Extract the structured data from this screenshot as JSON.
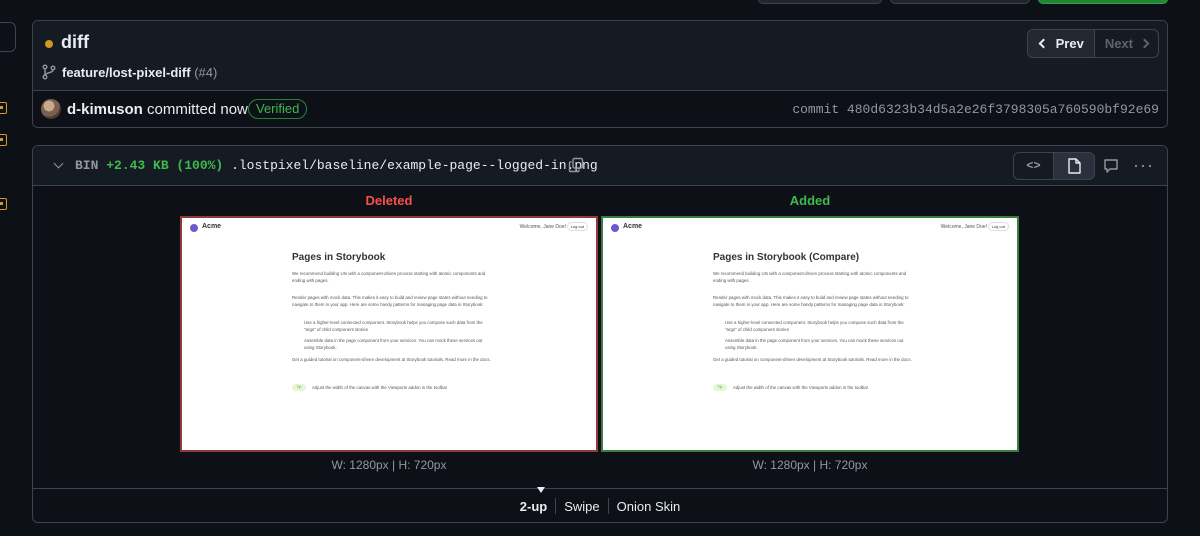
{
  "header": {
    "status_color": "#d29922",
    "title": "diff",
    "branch": "feature/lost-pixel-diff",
    "pr_number": "(#4)",
    "prev_label": "Prev",
    "next_label": "Next"
  },
  "commit": {
    "author": "d-kimuson",
    "when": "committed now",
    "verified_label": "Verified",
    "hash": "commit 480d6323b34d5a2e26f3798305a760590bf92e69"
  },
  "file": {
    "kind": "BIN",
    "size_change": "+2.43 KB (100%)",
    "path": ".lostpixel/baseline/example-page--logged-in.png",
    "source_toggle_glyph": "<>"
  },
  "deleted": {
    "label": "Deleted",
    "dims": "W: 1280px | H: 720px"
  },
  "added": {
    "label": "Added",
    "dims": "W: 1280px | H: 720px"
  },
  "storybook_old": {
    "brand": "Acme",
    "welcome": "Welcome, Jane Doe!",
    "logout": "Log out",
    "title": "Pages in Storybook",
    "p1": "We recommend building UIs with a component-driven process starting with atomic components and ending with pages.",
    "p2": "Render pages with mock data. This makes it easy to build and review page states without needing to navigate to them in your app. Here are some handy patterns for managing page data in Storybook:",
    "b1": "Use a higher-level connected component. Storybook helps you compose such data from the \"args\" of child component stories",
    "b2": "Assemble data in the page component from your services. You can mock these services out using Storybook.",
    "p3": "Get a guided tutorial on component-driven development at Storybook tutorials. Read more in the docs.",
    "tip_badge": "Tip",
    "tip": "Adjust the width of the canvas with the Viewports addon in the toolbar"
  },
  "storybook_new": {
    "brand": "Acme",
    "welcome": "Welcome, Jane Doe!",
    "logout": "Log out",
    "title": "Pages in Storybook (Compare)",
    "p1": "We recommend building UIs with a component-driven process starting with atomic components and ending with pages.",
    "p2": "Render pages with mock data. This makes it easy to build and review page states without needing to navigate to them in your app. Here are some handy patterns for managing page data in Storybook:",
    "b1": "Use a higher-level connected component. Storybook helps you compose such data from the \"args\" of child component stories",
    "b2": "Assemble data in the page component from your services. You can mock these services out using Storybook.",
    "p3": "Get a guided tutorial on component-driven development at Storybook tutorials. Read more in the docs.",
    "tip_badge": "Tip",
    "tip": "Adjust the width of the canvas with the Viewports addon in the toolbar"
  },
  "modes": {
    "two_up": "2-up",
    "swipe": "Swipe",
    "onion": "Onion Skin"
  },
  "colors": {
    "deleted": "#f85149",
    "added": "#3fb950",
    "verified": "#3fb950",
    "accent_bg": "#0d1117"
  }
}
